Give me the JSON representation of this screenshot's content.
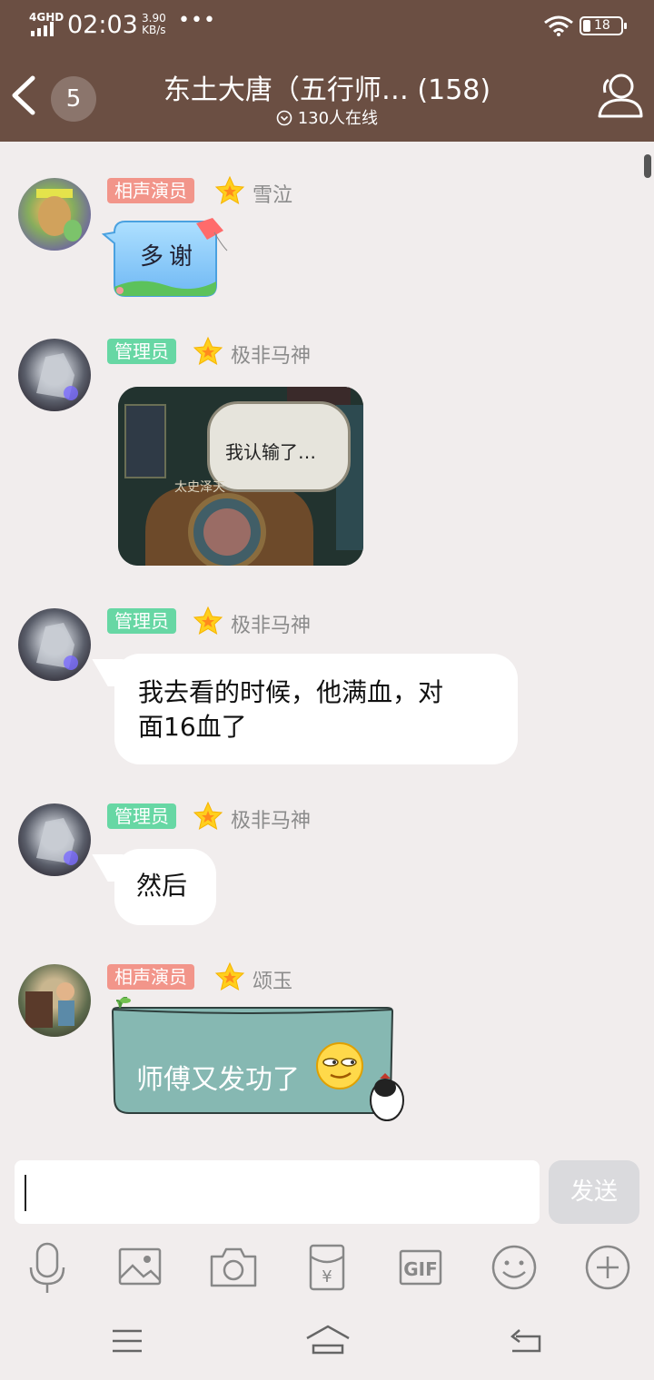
{
  "status_bar": {
    "network": "4GHD",
    "time": "02:03",
    "speed_value": "3.90",
    "speed_unit": "KB/s",
    "more": "•••",
    "battery": "18"
  },
  "header": {
    "back_count": "5",
    "title": "东土大唐（五行师… (158)",
    "online_text": "130人在线"
  },
  "messages": [
    {
      "tag": "相声演员",
      "name": "雪泣",
      "sticker_text": "多谢"
    },
    {
      "tag": "管理员",
      "name": "极非马神",
      "image_caption": "我认输了…",
      "image_subtext": "太史泽天"
    },
    {
      "tag": "管理员",
      "name": "极非马神",
      "text_line1": "我去看的时候，他满血，对",
      "text_line2": "面16血了"
    },
    {
      "tag": "管理员",
      "name": "极非马神",
      "text": "然后"
    },
    {
      "tag": "相声演员",
      "name": "颂玉",
      "sticker_text": "师傅又发功了"
    }
  ],
  "input": {
    "value": "",
    "send_label": "发送"
  },
  "toolbar": {
    "items": [
      "microphone-icon",
      "image-icon",
      "camera-icon",
      "red-packet-icon",
      "gif-icon",
      "emoji-icon",
      "plus-icon"
    ],
    "gif_label": "GIF",
    "yen": "¥"
  },
  "colors": {
    "header_bg": "#6b4f43",
    "page_bg": "#f1eded",
    "tag_red": "#f2958a",
    "tag_green": "#67d7a4"
  }
}
